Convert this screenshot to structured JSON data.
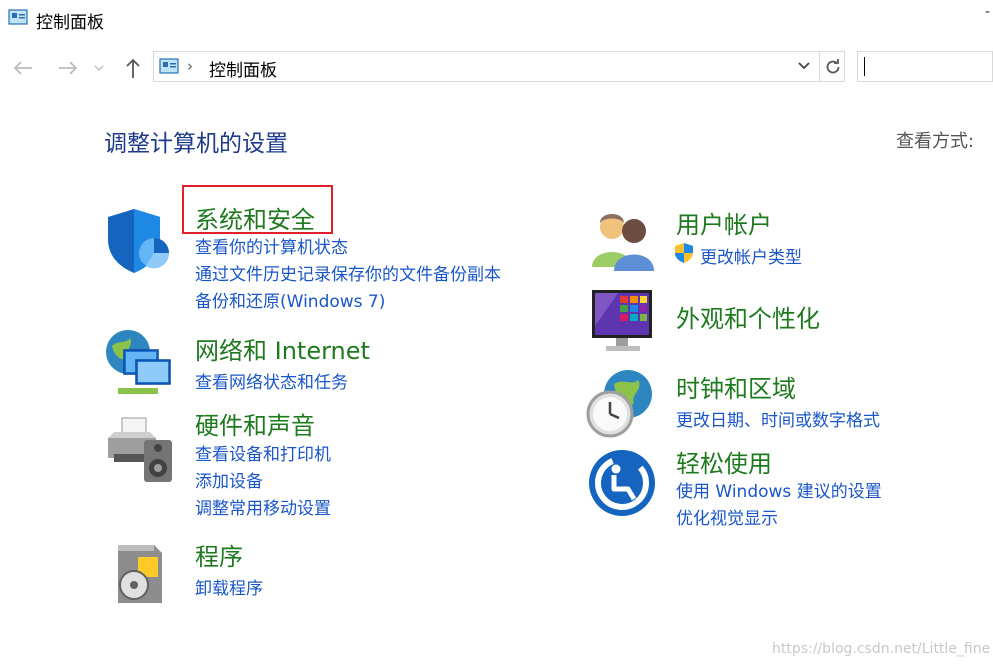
{
  "window": {
    "title": "控制面板"
  },
  "address": {
    "path": "控制面板"
  },
  "header": {
    "title": "调整计算机的设置",
    "view_by": "查看方式:"
  },
  "categories": {
    "system_security": {
      "title": "系统和安全",
      "links": [
        "查看你的计算机状态",
        "通过文件历史记录保存你的文件备份副本",
        "备份和还原(Windows 7)"
      ]
    },
    "network": {
      "title": "网络和 Internet",
      "links": [
        "查看网络状态和任务"
      ]
    },
    "hardware": {
      "title": "硬件和声音",
      "links": [
        "查看设备和打印机",
        "添加设备",
        "调整常用移动设置"
      ]
    },
    "programs": {
      "title": "程序",
      "links": [
        "卸载程序"
      ]
    },
    "user_accounts": {
      "title": "用户帐户",
      "links": [
        "更改帐户类型"
      ]
    },
    "appearance": {
      "title": "外观和个性化"
    },
    "clock_region": {
      "title": "时钟和区域",
      "links": [
        "更改日期、时间或数字格式"
      ]
    },
    "ease_of_access": {
      "title": "轻松使用",
      "links": [
        "使用 Windows 建议的设置",
        "优化视觉显示"
      ]
    }
  },
  "watermark": "https://blog.csdn.net/Little_fine",
  "colors": {
    "category_title": "#1f7a1f",
    "link": "#1a56c9",
    "page_title": "#1e3a8a",
    "highlight": "#e0202a"
  }
}
